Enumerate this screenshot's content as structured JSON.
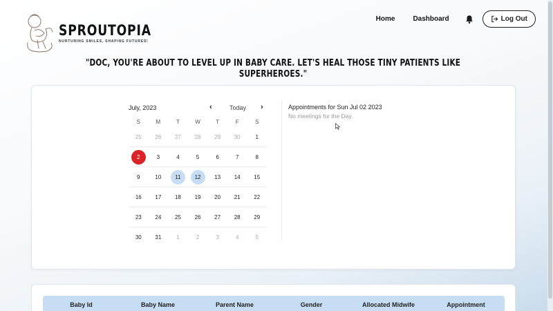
{
  "brand": {
    "name": "SPROUTOPIA",
    "tagline": "NURTURING SMILES, SHAPING FUTURES!"
  },
  "nav": {
    "home": "Home",
    "dashboard": "Dashboard",
    "bell_icon": "bell-icon",
    "logout": "Log Out",
    "logout_icon": "logout-icon"
  },
  "quote": "\"Doc, you're about to level up in baby care. Let's heal those tiny patients like superheroes.\"",
  "calendar": {
    "month_label": "July, 2023",
    "prev": "‹",
    "today": "Today",
    "next": "›",
    "weekdays": [
      "S",
      "M",
      "T",
      "W",
      "T",
      "F",
      "S"
    ],
    "weeks": [
      [
        {
          "d": "25",
          "m": true
        },
        {
          "d": "26",
          "m": true
        },
        {
          "d": "27",
          "m": true
        },
        {
          "d": "28",
          "m": true
        },
        {
          "d": "29",
          "m": true
        },
        {
          "d": "30",
          "m": true
        },
        {
          "d": "1"
        }
      ],
      [
        {
          "d": "2",
          "s": "selected"
        },
        {
          "d": "3"
        },
        {
          "d": "4"
        },
        {
          "d": "5"
        },
        {
          "d": "6"
        },
        {
          "d": "7"
        },
        {
          "d": "8"
        }
      ],
      [
        {
          "d": "9"
        },
        {
          "d": "10"
        },
        {
          "d": "11",
          "s": "highlight"
        },
        {
          "d": "12",
          "s": "highlight"
        },
        {
          "d": "13"
        },
        {
          "d": "14"
        },
        {
          "d": "15"
        }
      ],
      [
        {
          "d": "16"
        },
        {
          "d": "17"
        },
        {
          "d": "18"
        },
        {
          "d": "19"
        },
        {
          "d": "20"
        },
        {
          "d": "21"
        },
        {
          "d": "22"
        }
      ],
      [
        {
          "d": "23"
        },
        {
          "d": "24"
        },
        {
          "d": "25"
        },
        {
          "d": "26"
        },
        {
          "d": "27"
        },
        {
          "d": "28"
        },
        {
          "d": "29"
        }
      ],
      [
        {
          "d": "30"
        },
        {
          "d": "31"
        },
        {
          "d": "1",
          "m": true
        },
        {
          "d": "2",
          "m": true
        },
        {
          "d": "3",
          "m": true
        },
        {
          "d": "4",
          "m": true
        },
        {
          "d": "5",
          "m": true
        }
      ]
    ],
    "selected_color": "#d9252a",
    "highlight_color": "#c7ddf4"
  },
  "appointments": {
    "title": "Appointments for Sun Jul 02 2023",
    "empty": "No meetings for the Day."
  },
  "table": {
    "columns": [
      "Baby Id",
      "Baby Name",
      "Parent Name",
      "Gender",
      "Allocated Midwife",
      "Appointment"
    ],
    "header_color": "#c7ddf4"
  }
}
